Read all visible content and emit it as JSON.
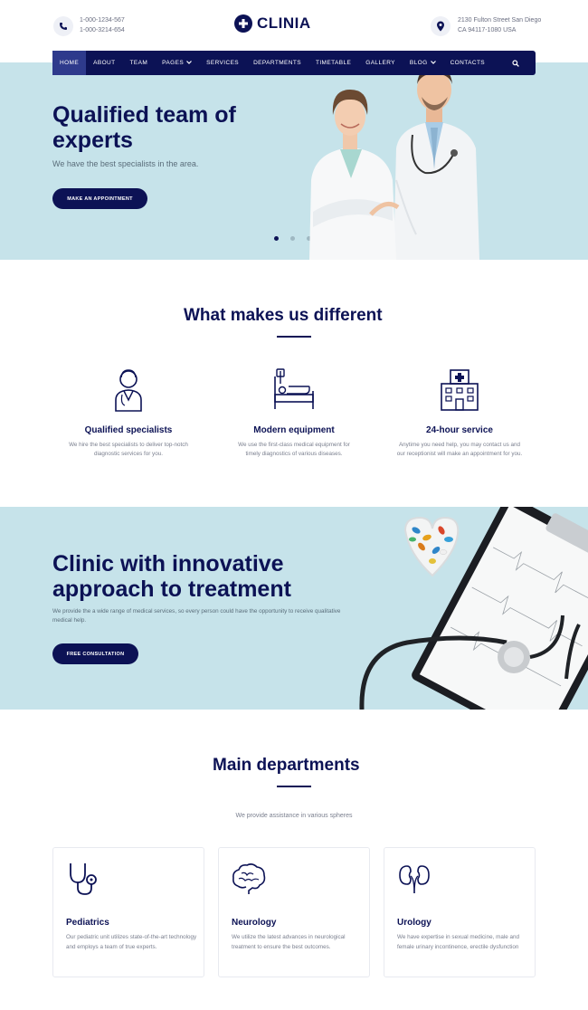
{
  "header": {
    "phones": [
      "1-000-1234-567",
      "1-000-3214-654"
    ],
    "logo_text": "CLINIA",
    "address": [
      "2130 Fulton Street San Diego",
      "CA 94117-1080 USA"
    ]
  },
  "nav": {
    "items": [
      "HOME",
      "ABOUT",
      "TEAM",
      "PAGES",
      "SERVICES",
      "DEPARTMENTS",
      "TIMETABLE",
      "GALLERY",
      "BLOG",
      "CONTACTS"
    ],
    "active": "HOME"
  },
  "hero": {
    "title": "Qualified team of experts",
    "subtitle": "We have the best specialists in the area.",
    "button": "MAKE AN APPOINTMENT",
    "slides_total": 3,
    "slide_active": 1
  },
  "different": {
    "title": "What makes us different",
    "features": [
      {
        "title": "Qualified specialists",
        "text": "We hire the best specialists to deliver top-notch diagnostic services for you.",
        "icon": "doctor-icon"
      },
      {
        "title": "Modern equipment",
        "text": "We use the first-class medical equipment for timely diagnostics of various diseases.",
        "icon": "hospital-bed-icon"
      },
      {
        "title": "24-hour service",
        "text": "Anytime you need help, you may contact us and our receptionist will make an appointment for you.",
        "icon": "hospital-building-icon"
      }
    ]
  },
  "banner": {
    "title": "Clinic with innovative approach to treatment",
    "text": "We provide the a wide range of medical services, so every person could have the opportunity to receive qualitative medical help.",
    "button": "FREE CONSULTATION"
  },
  "departments": {
    "title": "Main departments",
    "subtitle": "We provide assistance in various spheres",
    "cards": [
      {
        "title": "Pediatrics",
        "text": "Our pediatric unit utilizes state-of-the-art technology and employs a team of true experts.",
        "icon": "stethoscope-icon"
      },
      {
        "title": "Neurology",
        "text": "We utilize the latest advances in neurological treatment to ensure the best outcomes.",
        "icon": "brain-icon"
      },
      {
        "title": "Urology",
        "text": "We have expertise in sexual medicine, male and female urinary incontinence, erectile dysfunction",
        "icon": "kidneys-icon"
      }
    ]
  },
  "colors": {
    "navy": "#0c1255",
    "light_blue": "#c6e3ea",
    "nav_active": "#2e3a8c"
  }
}
